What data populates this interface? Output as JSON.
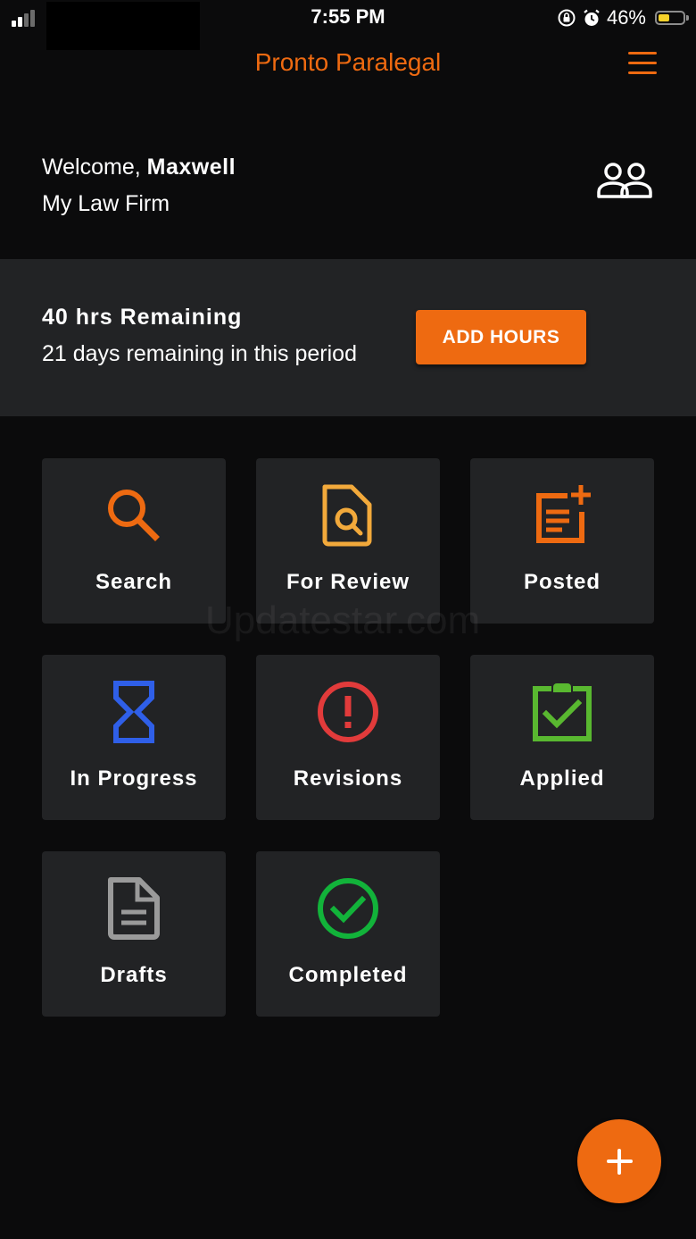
{
  "status_bar": {
    "time": "7:55 PM",
    "battery_percent": "46%",
    "battery_level": 0.46,
    "signal_bars": 2
  },
  "app": {
    "title": "Pronto Paralegal",
    "accent_color": "#ee6a11",
    "menu_icon": "hamburger-menu-icon"
  },
  "welcome": {
    "greeting": "Welcome,",
    "user_name": "Maxwell",
    "firm_name": "My Law Firm",
    "team_icon": "team-icon"
  },
  "hours": {
    "remaining": "40 hrs Remaining",
    "period_note": "21 days remaining in this period",
    "add_button_label": "ADD HOURS"
  },
  "tiles": [
    {
      "label": "Search",
      "icon": "search-icon",
      "color": "#ee6a11"
    },
    {
      "label": "For Review",
      "icon": "document-search-icon",
      "color": "#f2a93b"
    },
    {
      "label": "Posted",
      "icon": "post-add-icon",
      "color": "#ee6a11"
    },
    {
      "label": "In Progress",
      "icon": "hourglass-icon",
      "color": "#2f5fe8"
    },
    {
      "label": "Revisions",
      "icon": "alert-circle-icon",
      "color": "#e23b3b"
    },
    {
      "label": "Applied",
      "icon": "clipboard-check-icon",
      "color": "#59b830"
    },
    {
      "label": "Drafts",
      "icon": "document-icon",
      "color": "#9a9a9a"
    },
    {
      "label": "Completed",
      "icon": "check-circle-icon",
      "color": "#12b33a"
    }
  ],
  "watermark": "Updatestar.com",
  "fab": {
    "icon": "plus-icon"
  }
}
